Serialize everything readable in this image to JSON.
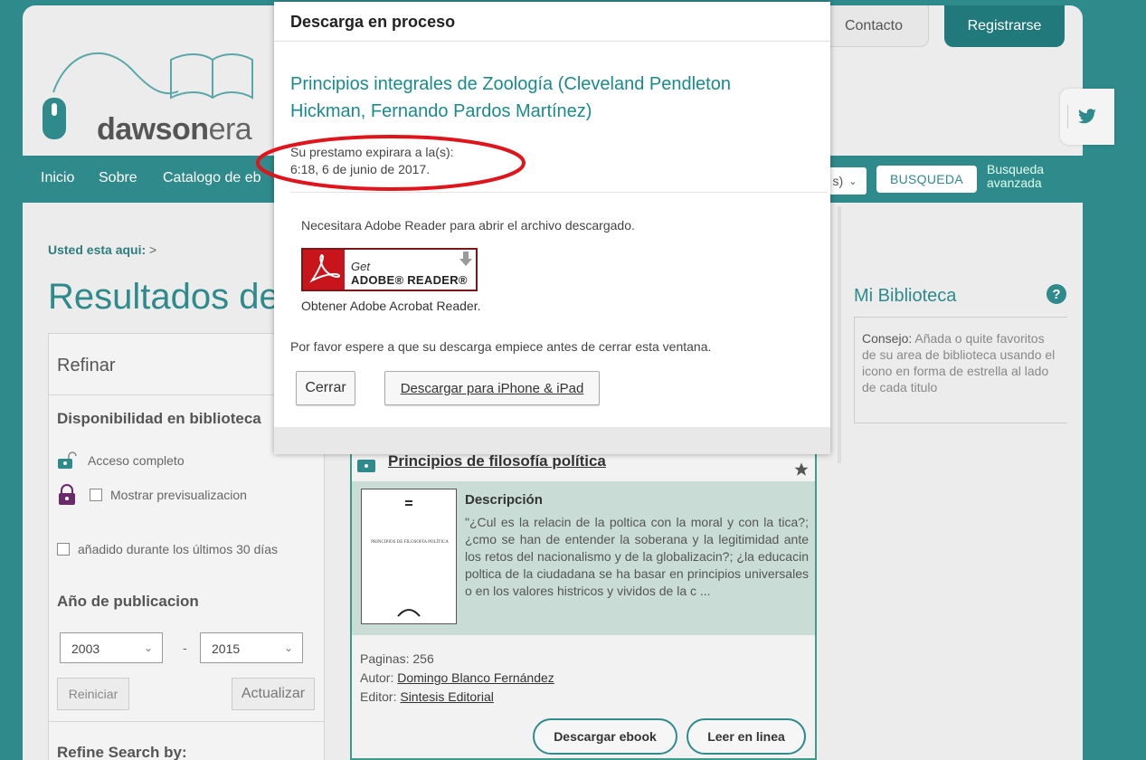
{
  "header": {
    "logo_bold": "dawson",
    "logo_light": "era",
    "contact_label": "Contacto",
    "register_label": "Registrarse"
  },
  "nav": {
    "items": [
      "Inicio",
      "Sobre",
      "Catalogo de eb"
    ],
    "select_value": "s)",
    "search_label": "BUSQUEDA",
    "advanced_line1": "Busqueda",
    "advanced_line2": "avanzada"
  },
  "breadcrumb": {
    "label": "Usted esta aqui:",
    "sep": ">"
  },
  "main": {
    "results_title": "Resultados de"
  },
  "refine": {
    "title": "Refinar",
    "availability_title": "Disponibilidad en biblioteca",
    "full_access": "Acceso completo",
    "show_preview": "Mostrar previsualizacion",
    "added_recent": "añadido durante los últimos 30 días",
    "year_title": "Año de publicacion",
    "year_from": "2003",
    "year_dash": "-",
    "year_to": "2015",
    "reset_label": "Reiniciar",
    "update_label": "Actualizar",
    "refine_by": "Refine Search by:"
  },
  "result": {
    "title": "Principios de filosofía política",
    "desc_heading": "Descripción",
    "cover_text": "PRINCIPIOS DE FILOSOFÍA POLÍTICA",
    "description": "\"¿Cul es la relacin de la poltica con la moral y con la tica?; ¿cmo se han de entender la soberana y la legitimidad ante los retos del nacionalismo y de la globalizacin?; ¿la educacin poltica de la ciudadana se ha basar en principios universales o en los valores histricos y vividos de la c ...",
    "pages": "Paginas: 256",
    "author_label": "Autor:",
    "author": "Domingo Blanco Fernández",
    "publisher_label": "Editor:",
    "publisher": "Sintesis Editorial",
    "download_label": "Descargar ebook",
    "read_label": "Leer en linea"
  },
  "library": {
    "title": "Mi Biblioteca",
    "help": "?",
    "tip_label": "Consejo:",
    "tip_text": "Añada o quite favoritos de su area de biblioteca usando el icono en forma de estrella al lado de cada titulo"
  },
  "modal": {
    "heading": "Descarga en proceso",
    "book_title": "Principios integrales de Zoología (Cleveland Pendleton Hickman, Fernando Pardos Martínez)",
    "expiry_line1": "Su prestamo expirara a la(s):",
    "expiry_line2": "6:18, 6 de junio de 2017.",
    "need_reader": "Necesitara Adobe Reader para abrir el archivo descargado.",
    "adobe_get": "Get",
    "adobe_reader": "ADOBE® READER®",
    "obtain_reader": "Obtener Adobe Acrobat Reader.",
    "wait_msg": "Por favor espere a que su descarga empiece antes de cerrar esta ventana.",
    "close_label": "Cerrar",
    "ios_label": "Descargar para iPhone & iPad"
  },
  "colors": {
    "teal": "#2f8a8c",
    "annotation_red": "#e0141b",
    "adobe_red": "#c8151c"
  }
}
